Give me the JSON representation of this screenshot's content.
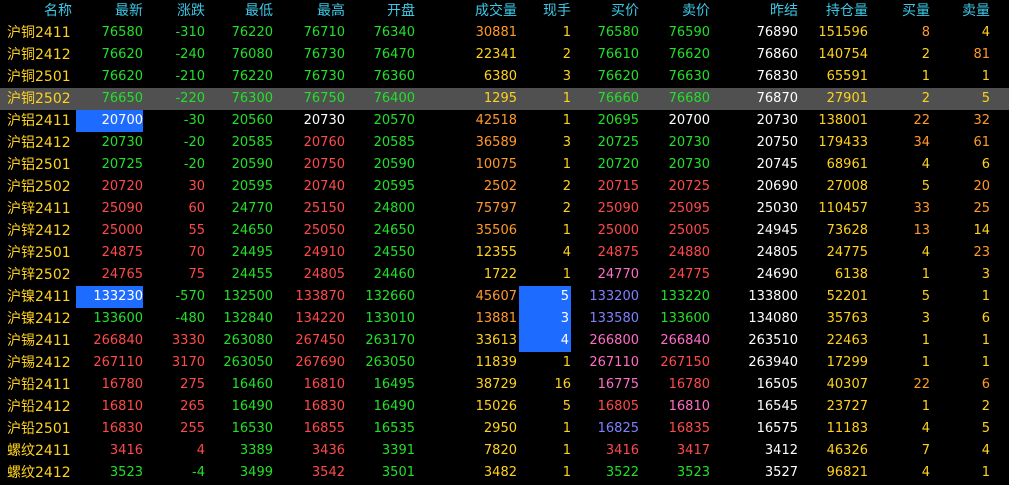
{
  "headers": [
    "名称",
    "最新",
    "涨跌",
    "最低",
    "最高",
    "开盘",
    "成交量",
    "现手",
    "买价",
    "卖价",
    "昨结",
    "持仓量",
    "买量",
    "卖量"
  ],
  "colors": {
    "up": "#ff4a4a",
    "down": "#22e02a",
    "flat": "#ffffff",
    "volume": "#ffd21e",
    "name": "#ffd21e",
    "buy_price_alt": "#ff6ec7",
    "buy_price_blue": "#8080ff",
    "header": "#3cc8e6",
    "highlight": "#1e6cff",
    "selected_row": "#505050",
    "orange": "#ff9a2a"
  },
  "selected_row": 3,
  "rows": [
    {
      "name": "沪铜2411",
      "last": "76580",
      "chg": "-310",
      "low": "76220",
      "high": "76710",
      "open": "76340",
      "vol": "30881",
      "hand": "1",
      "bid": "76580",
      "ask": "76590",
      "settle": "76890",
      "oi": "151596",
      "bidv": "8",
      "askv": "4"
    },
    {
      "name": "沪铜2412",
      "last": "76620",
      "chg": "-240",
      "low": "76080",
      "high": "76730",
      "open": "76470",
      "vol": "22341",
      "hand": "2",
      "bid": "76610",
      "ask": "76620",
      "settle": "76860",
      "oi": "140754",
      "bidv": "2",
      "askv": "81"
    },
    {
      "name": "沪铜2501",
      "last": "76620",
      "chg": "-210",
      "low": "76220",
      "high": "76730",
      "open": "76360",
      "vol": "6380",
      "hand": "3",
      "bid": "76620",
      "ask": "76630",
      "settle": "76830",
      "oi": "65591",
      "bidv": "1",
      "askv": "1"
    },
    {
      "name": "沪铜2502",
      "last": "76650",
      "chg": "-220",
      "low": "76300",
      "high": "76750",
      "open": "76400",
      "vol": "1295",
      "hand": "1",
      "bid": "76660",
      "ask": "76680",
      "settle": "76870",
      "oi": "27901",
      "bidv": "2",
      "askv": "5"
    },
    {
      "name": "沪铝2411",
      "last": "20700",
      "chg": "-30",
      "low": "20560",
      "high": "20730",
      "open": "20570",
      "vol": "42518",
      "hand": "1",
      "bid": "20695",
      "ask": "20700",
      "settle": "20730",
      "oi": "138001",
      "bidv": "22",
      "askv": "32"
    },
    {
      "name": "沪铝2412",
      "last": "20730",
      "chg": "-20",
      "low": "20585",
      "high": "20760",
      "open": "20585",
      "vol": "36589",
      "hand": "3",
      "bid": "20725",
      "ask": "20730",
      "settle": "20750",
      "oi": "179433",
      "bidv": "34",
      "askv": "61"
    },
    {
      "name": "沪铝2501",
      "last": "20725",
      "chg": "-20",
      "low": "20590",
      "high": "20750",
      "open": "20590",
      "vol": "10075",
      "hand": "1",
      "bid": "20720",
      "ask": "20730",
      "settle": "20745",
      "oi": "68961",
      "bidv": "4",
      "askv": "6"
    },
    {
      "name": "沪铝2502",
      "last": "20720",
      "chg": "30",
      "low": "20595",
      "high": "20740",
      "open": "20595",
      "vol": "2502",
      "hand": "2",
      "bid": "20715",
      "ask": "20725",
      "settle": "20690",
      "oi": "27008",
      "bidv": "5",
      "askv": "20"
    },
    {
      "name": "沪锌2411",
      "last": "25090",
      "chg": "60",
      "low": "24770",
      "high": "25150",
      "open": "24800",
      "vol": "75797",
      "hand": "2",
      "bid": "25090",
      "ask": "25095",
      "settle": "25030",
      "oi": "110457",
      "bidv": "33",
      "askv": "25"
    },
    {
      "name": "沪锌2412",
      "last": "25000",
      "chg": "55",
      "low": "24650",
      "high": "25050",
      "open": "24650",
      "vol": "35506",
      "hand": "1",
      "bid": "25000",
      "ask": "25005",
      "settle": "24945",
      "oi": "73628",
      "bidv": "13",
      "askv": "14"
    },
    {
      "name": "沪锌2501",
      "last": "24875",
      "chg": "70",
      "low": "24495",
      "high": "24910",
      "open": "24550",
      "vol": "12355",
      "hand": "4",
      "bid": "24875",
      "ask": "24880",
      "settle": "24805",
      "oi": "24775",
      "bidv": "4",
      "askv": "23"
    },
    {
      "name": "沪锌2502",
      "last": "24765",
      "chg": "75",
      "low": "24455",
      "high": "24805",
      "open": "24460",
      "vol": "1722",
      "hand": "1",
      "bid": "24770",
      "ask": "24775",
      "settle": "24690",
      "oi": "6138",
      "bidv": "1",
      "askv": "3"
    },
    {
      "name": "沪镍2411",
      "last": "133230",
      "chg": "-570",
      "low": "132500",
      "high": "133870",
      "open": "132660",
      "vol": "45607",
      "hand": "5",
      "bid": "133200",
      "ask": "133220",
      "settle": "133800",
      "oi": "52201",
      "bidv": "5",
      "askv": "1"
    },
    {
      "name": "沪镍2412",
      "last": "133600",
      "chg": "-480",
      "low": "132840",
      "high": "134220",
      "open": "133010",
      "vol": "13881",
      "hand": "3",
      "bid": "133580",
      "ask": "133600",
      "settle": "134080",
      "oi": "35763",
      "bidv": "3",
      "askv": "6"
    },
    {
      "name": "沪锡2411",
      "last": "266840",
      "chg": "3330",
      "low": "263080",
      "high": "267450",
      "open": "263170",
      "vol": "33613",
      "hand": "4",
      "bid": "266800",
      "ask": "266840",
      "settle": "263510",
      "oi": "22463",
      "bidv": "1",
      "askv": "1"
    },
    {
      "name": "沪锡2412",
      "last": "267110",
      "chg": "3170",
      "low": "263050",
      "high": "267690",
      "open": "263050",
      "vol": "11839",
      "hand": "1",
      "bid": "267110",
      "ask": "267150",
      "settle": "263940",
      "oi": "17299",
      "bidv": "1",
      "askv": "1"
    },
    {
      "name": "沪铅2411",
      "last": "16780",
      "chg": "275",
      "low": "16460",
      "high": "16810",
      "open": "16495",
      "vol": "38729",
      "hand": "16",
      "bid": "16775",
      "ask": "16780",
      "settle": "16505",
      "oi": "40307",
      "bidv": "22",
      "askv": "6"
    },
    {
      "name": "沪铅2412",
      "last": "16810",
      "chg": "265",
      "low": "16490",
      "high": "16830",
      "open": "16490",
      "vol": "15026",
      "hand": "5",
      "bid": "16805",
      "ask": "16810",
      "settle": "16545",
      "oi": "23727",
      "bidv": "1",
      "askv": "2"
    },
    {
      "name": "沪铅2501",
      "last": "16830",
      "chg": "255",
      "low": "16530",
      "high": "16855",
      "open": "16535",
      "vol": "2950",
      "hand": "1",
      "bid": "16825",
      "ask": "16835",
      "settle": "16575",
      "oi": "11183",
      "bidv": "4",
      "askv": "5"
    },
    {
      "name": "螺纹2411",
      "last": "3416",
      "chg": "4",
      "low": "3389",
      "high": "3436",
      "open": "3391",
      "vol": "7820",
      "hand": "1",
      "bid": "3416",
      "ask": "3417",
      "settle": "3412",
      "oi": "46326",
      "bidv": "7",
      "askv": "4"
    },
    {
      "name": "螺纹2412",
      "last": "3523",
      "chg": "-4",
      "low": "3499",
      "high": "3542",
      "open": "3501",
      "vol": "3482",
      "hand": "1",
      "bid": "3522",
      "ask": "3523",
      "settle": "3527",
      "oi": "96821",
      "bidv": "4",
      "askv": "1"
    }
  ]
}
